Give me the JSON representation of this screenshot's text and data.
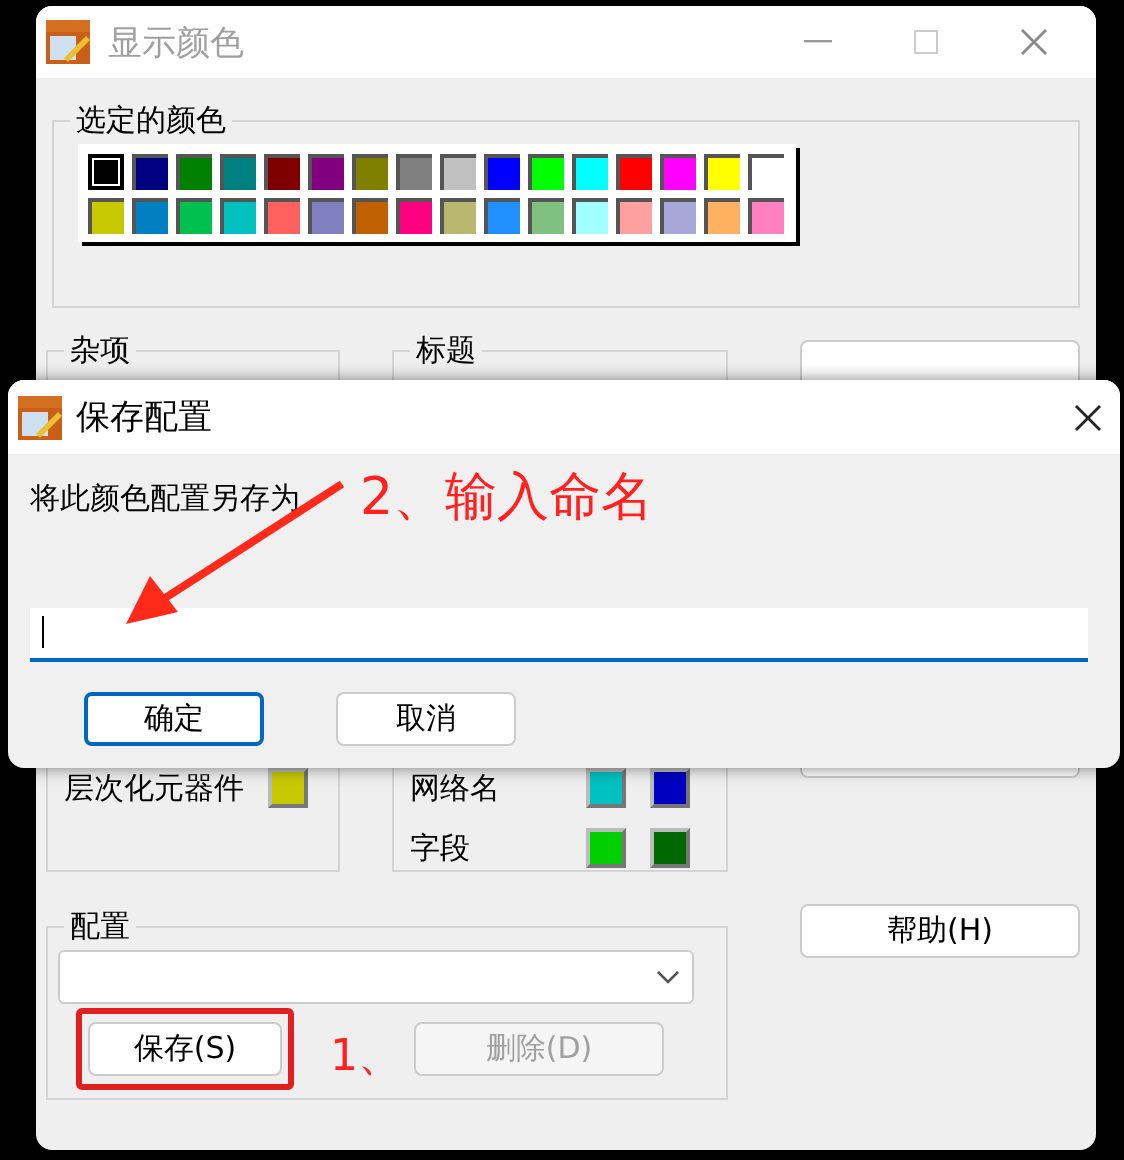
{
  "main_window": {
    "title": "显示颜色",
    "selected_colors": {
      "label": "选定的颜色",
      "rows": [
        [
          {
            "color": "#000000",
            "selected": true
          },
          {
            "color": "#000080",
            "selected": false
          },
          {
            "color": "#008000",
            "selected": false
          },
          {
            "color": "#008080",
            "selected": false
          },
          {
            "color": "#800000",
            "selected": false
          },
          {
            "color": "#800080",
            "selected": false
          },
          {
            "color": "#808000",
            "selected": false
          },
          {
            "color": "#808080",
            "selected": false
          },
          {
            "color": "#c0c0c0",
            "selected": false
          },
          {
            "color": "#0000ff",
            "selected": false
          },
          {
            "color": "#00ff00",
            "selected": false
          },
          {
            "color": "#00ffff",
            "selected": false
          },
          {
            "color": "#ff0000",
            "selected": false
          },
          {
            "color": "#ff00ff",
            "selected": false
          },
          {
            "color": "#ffff00",
            "selected": false
          },
          {
            "color": "#ffffff",
            "selected": false
          }
        ],
        [
          {
            "color": "#c8c800",
            "selected": false
          },
          {
            "color": "#0080c0",
            "selected": false
          },
          {
            "color": "#00c050",
            "selected": false
          },
          {
            "color": "#00c0c0",
            "selected": false
          },
          {
            "color": "#ff6060",
            "selected": false
          },
          {
            "color": "#8080c0",
            "selected": false
          },
          {
            "color": "#c06000",
            "selected": false
          },
          {
            "color": "#ff0080",
            "selected": false
          },
          {
            "color": "#b8b870",
            "selected": false
          },
          {
            "color": "#2090ff",
            "selected": false
          },
          {
            "color": "#80c080",
            "selected": false
          },
          {
            "color": "#a0ffff",
            "selected": false
          },
          {
            "color": "#ffa0a0",
            "selected": false
          },
          {
            "color": "#a8a8d8",
            "selected": false
          },
          {
            "color": "#ffb060",
            "selected": false
          },
          {
            "color": "#ff80c0",
            "selected": false
          }
        ]
      ]
    },
    "misc": {
      "label": "杂项",
      "items": [
        {
          "label": "层次化元器件",
          "swatches": [
            {
              "color": "#c8c800"
            }
          ]
        }
      ]
    },
    "titles": {
      "label": "标题",
      "items": [
        {
          "label": "网络名",
          "swatches": [
            {
              "color": "#00c0c0"
            },
            {
              "color": "#0000c0"
            }
          ]
        },
        {
          "label": "字段",
          "swatches": [
            {
              "color": "#00d000"
            },
            {
              "color": "#006800"
            }
          ]
        }
      ]
    },
    "help_button": {
      "label": "帮助(H)"
    },
    "config": {
      "label": "配置",
      "buttons": [
        {
          "label": "保存(S)",
          "disabled": false,
          "highlighted": true
        },
        {
          "label": "删除(D)",
          "disabled": true,
          "highlighted": false
        }
      ]
    }
  },
  "annotations": {
    "step_1": "1、",
    "step_2": "2、输入命名"
  },
  "dialog": {
    "title": "保存配置",
    "prompt": "将此颜色配置另存为",
    "buttons": [
      {
        "label": "确定",
        "default": true
      },
      {
        "label": "取消",
        "default": false
      }
    ]
  }
}
